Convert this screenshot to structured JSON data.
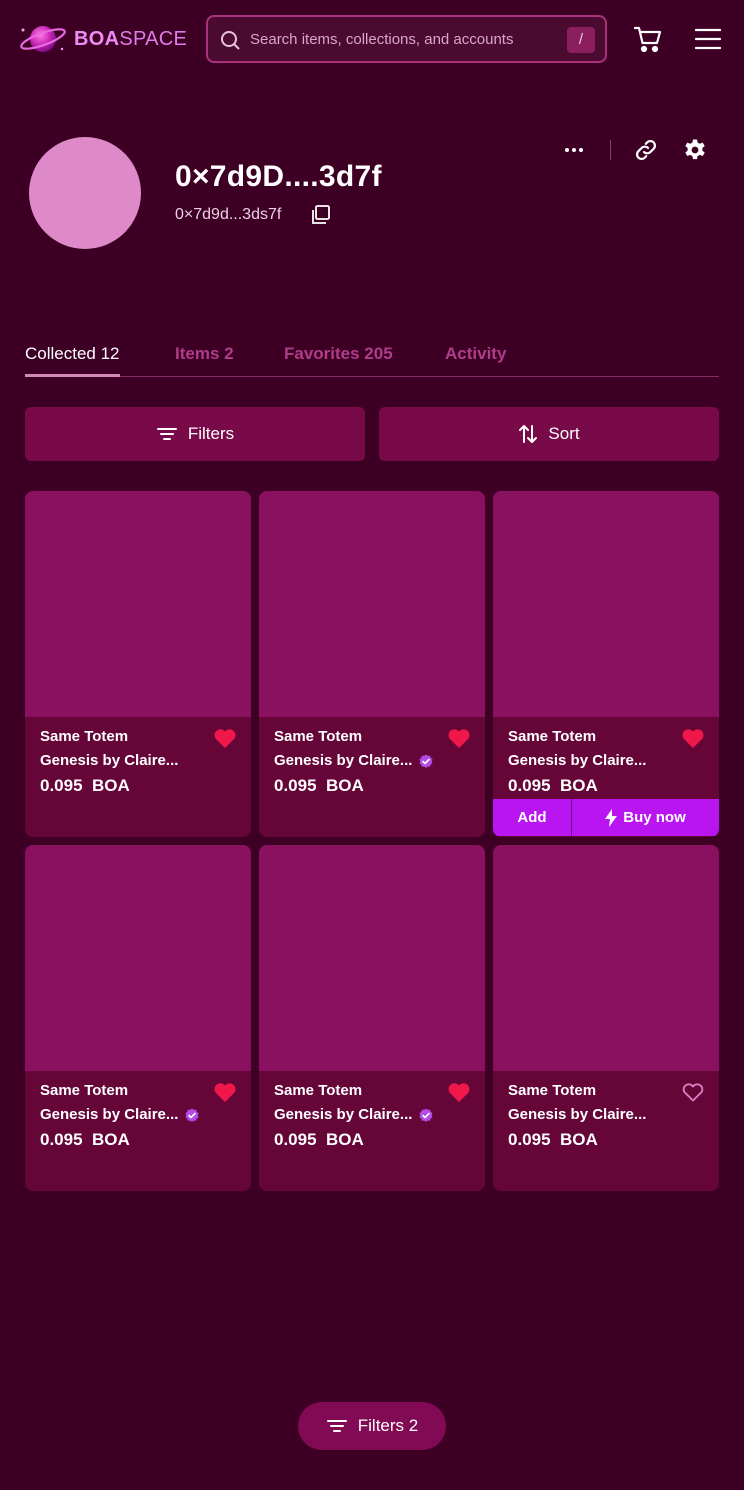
{
  "header": {
    "logo_bold": "BOA",
    "logo_light": "SPACE",
    "search_placeholder": "Search items, collections, and accounts",
    "search_shortcut": "/"
  },
  "profile": {
    "name": "0×7d9D....3d7f",
    "address": "0×7d9d...3ds7f"
  },
  "tabs": [
    {
      "label": "Collected 12",
      "active": true
    },
    {
      "label": "Items 2",
      "active": false
    },
    {
      "label": "Favorites 205",
      "active": false
    },
    {
      "label": "Activity",
      "active": false
    }
  ],
  "toolbar": {
    "filters_label": "Filters",
    "sort_label": "Sort"
  },
  "cards": [
    {
      "title": "Same Totem",
      "subtitle": "Genesis by Claire...",
      "price": "0.095",
      "currency": "BOA",
      "verified": false,
      "favorited": true
    },
    {
      "title": "Same Totem",
      "subtitle": "Genesis by Claire...",
      "price": "0.095",
      "currency": "BOA",
      "verified": true,
      "favorited": true
    },
    {
      "title": "Same Totem",
      "subtitle": "Genesis by Claire...",
      "price": "0.095",
      "currency": "BOA",
      "verified": false,
      "favorited": true,
      "add_label": "Add",
      "buy_label": "Buy now"
    },
    {
      "title": "Same Totem",
      "subtitle": "Genesis by Claire...",
      "price": "0.095",
      "currency": "BOA",
      "verified": true,
      "favorited": true
    },
    {
      "title": "Same Totem",
      "subtitle": "Genesis by Claire...",
      "price": "0.095",
      "currency": "BOA",
      "verified": true,
      "favorited": true
    },
    {
      "title": "Same Totem",
      "subtitle": "Genesis by Claire...",
      "price": "0.095",
      "currency": "BOA",
      "verified": false,
      "favorited": false
    }
  ],
  "floating_filter": {
    "label": "Filters 2"
  },
  "colors": {
    "background": "#3d0024",
    "card": "#650538",
    "card_image": "#8a1160",
    "accent": "#b815f0",
    "heart": "#f0174a",
    "avatar": "#de8ac9"
  }
}
